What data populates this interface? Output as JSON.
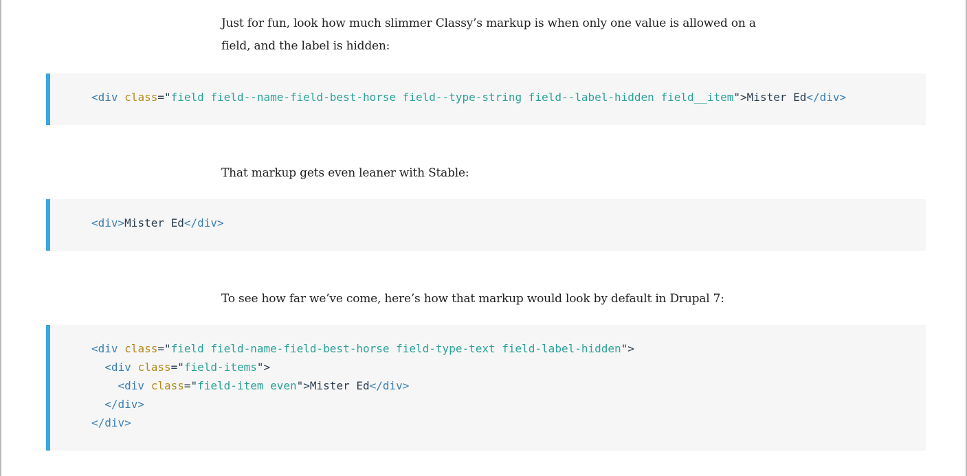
{
  "paragraphs": {
    "p1_line1": "Just for fun, look how much slimmer Classy’s markup is when only one value is allowed on a",
    "p1_line2": "field, and the label is hidden:",
    "p2": "That markup gets even leaner with Stable:",
    "p3": "To see how far we’ve come, here’s how that markup would look by default in Drupal 7:"
  },
  "code": {
    "block1": {
      "open": "<div",
      "attr": "class",
      "eq_quote": "=\"",
      "value": "field field--name-field-best-horse field--type-string field--label-hidden field__item",
      "quote_close": "\">",
      "text": "Mister Ed",
      "close": "</div>"
    },
    "block2": {
      "open": "<div>",
      "text": "Mister Ed",
      "close": "</div>"
    },
    "block3": {
      "l1_open": "<div",
      "l1_attr": "class",
      "l1_eq": "=\"",
      "l1_value": "field field-name-field-best-horse field-type-text field-label-hidden",
      "l1_end": "\">",
      "l2_open": "<div",
      "l2_attr": "class",
      "l2_eq": "=\"",
      "l2_value": "field-items",
      "l2_end": "\">",
      "l3_open": "<div",
      "l3_attr": "class",
      "l3_eq": "=\"",
      "l3_value": "field-item even",
      "l3_end": "\">",
      "l3_text": "Mister Ed",
      "l3_close": "</div>",
      "l4_close": "</div>",
      "l5_close": "</div>"
    }
  },
  "colors": {
    "accent_border": "#3aa7e0",
    "code_background": "#f6f6f6",
    "tag": "#3a7fb2",
    "attribute": "#b48a1c",
    "string": "#2aa198"
  }
}
